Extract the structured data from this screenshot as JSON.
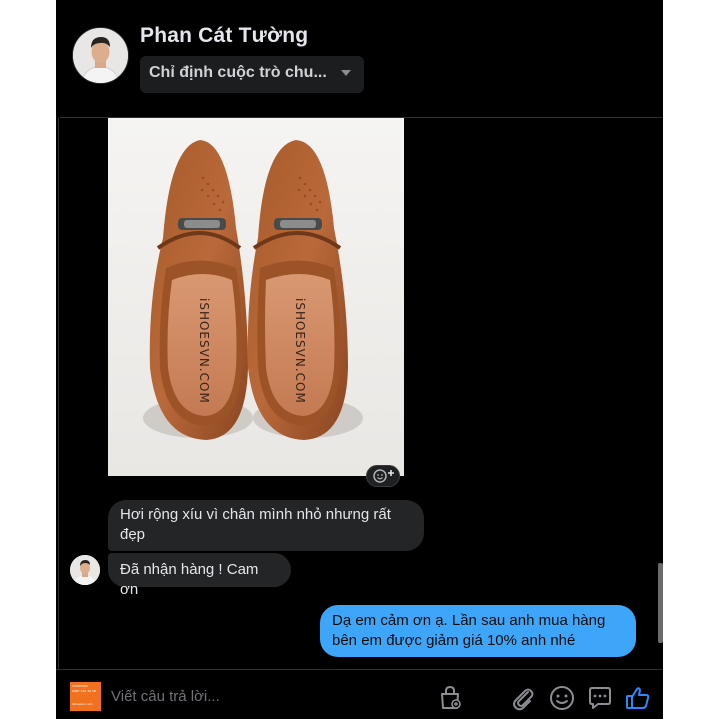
{
  "header": {
    "contact_name": "Phan Cát Tường",
    "conversation_select": "Chỉ định cuộc trò chu..."
  },
  "product_image": {
    "insole_brand": "iSHOESVN.COM"
  },
  "messages": [
    {
      "direction": "incoming",
      "text": "Hơi rộng xíu vì chân mình nhỏ nhưng rất đẹp"
    },
    {
      "direction": "incoming",
      "text": "Đã nhận hàng ! Cam ơn"
    },
    {
      "direction": "outgoing",
      "text": "Dạ em cảm ơn ạ. Lần sau anh mua hàng bên em được giảm giá 10% anh nhé"
    }
  ],
  "composer": {
    "placeholder": "Viết câu trả lời...",
    "page_logo_text": [
      "iSHOESVN",
      "0987 566 36 58",
      "ishoesvn.com"
    ]
  },
  "icons": {
    "react": "add-reaction-icon",
    "dropdown": "chevron-down-icon",
    "shop": "shopping-bag-icon",
    "attach": "paperclip-icon",
    "emoji": "smiley-icon",
    "saved": "chat-bubble-icon",
    "like": "thumbs-up-icon"
  },
  "colors": {
    "background": "#000000",
    "incoming_bubble": "#242526",
    "outgoing_bubble": "#3ea6f8",
    "like_icon": "#2d88ff",
    "text": "#e4e6eb"
  }
}
